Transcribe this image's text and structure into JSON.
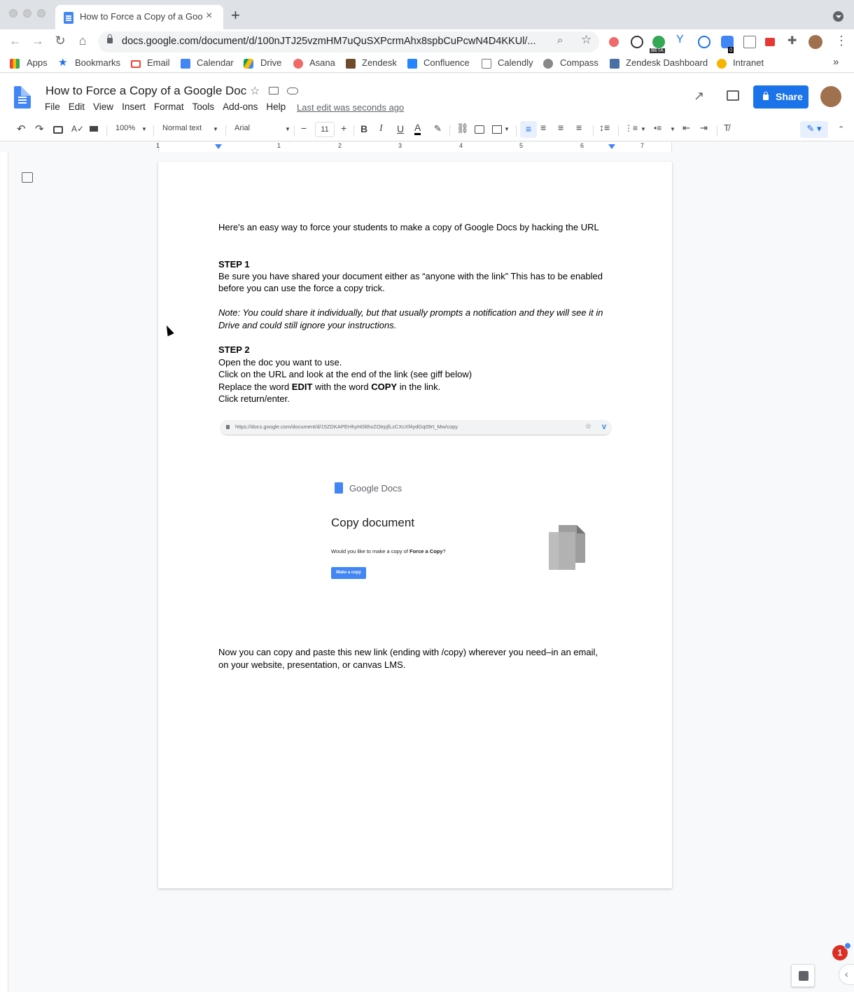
{
  "browser": {
    "tab_title": "How to Force a Copy of a Goog",
    "tab_close": "×",
    "new_tab": "+",
    "url": "docs.google.com/document/d/100nJTJ25vzmHM7uQuSXPcrmAhx8spbCuPcwN4D4KKUl/...",
    "extension_badges": {
      "beta": "BETA",
      "count": "0"
    }
  },
  "bookmarks": [
    {
      "label": "Apps",
      "icon": "apps-grid-icon"
    },
    {
      "label": "Bookmarks",
      "icon": "star-icon"
    },
    {
      "label": "Email",
      "icon": "gmail-icon"
    },
    {
      "label": "Calendar",
      "icon": "calendar-icon"
    },
    {
      "label": "Drive",
      "icon": "drive-icon"
    },
    {
      "label": "Asana",
      "icon": "asana-icon"
    },
    {
      "label": "Zendesk",
      "icon": "zendesk-icon"
    },
    {
      "label": "Confluence",
      "icon": "confluence-icon"
    },
    {
      "label": "Calendly",
      "icon": "calendly-icon"
    },
    {
      "label": "Compass",
      "icon": "compass-icon"
    },
    {
      "label": "Zendesk Dashboard",
      "icon": "zendesk-dashboard-icon"
    },
    {
      "label": "Intranet",
      "icon": "intranet-icon"
    }
  ],
  "bookmarks_more": "»",
  "doc": {
    "title": "How to Force a Copy of a Google Doc",
    "menu": [
      "File",
      "Edit",
      "View",
      "Insert",
      "Format",
      "Tools",
      "Add-ons",
      "Help"
    ],
    "last_edit": "Last edit was seconds ago",
    "share_label": "Share"
  },
  "toolbar": {
    "zoom": "100%",
    "style": "Normal text",
    "font": "Arial",
    "font_size": "11",
    "minus": "−",
    "plus": "+",
    "bold": "B",
    "italic": "I",
    "underline": "U",
    "text_color": "A"
  },
  "ruler_numbers": [
    "1",
    "1",
    "2",
    "3",
    "4",
    "5",
    "6",
    "7"
  ],
  "content": {
    "intro": "Here's an easy way to force your students to make a copy of Google Docs by hacking the URL",
    "step1_heading": "STEP 1",
    "step1_line1": "Be sure you have shared your document either as “anyone with the link” This has to be enabled",
    "step1_line2": "before you can use the force a copy trick.",
    "note_line1": "Note: You could share it individually, but that usually prompts a notification and they will see it in",
    "note_line2": "Drive and could still ignore your instructions.",
    "step2_heading": "STEP 2",
    "step2_line1": "Open the doc you want to use.",
    "step2_line2": "Click on the URL and look at the end of the link (see giff below)",
    "step2_line3_a": "Replace the word ",
    "step2_line3_edit": "EDIT",
    "step2_line3_b": " with the word ",
    "step2_line3_copy": "COPY",
    "step2_line3_c": " in the link.",
    "step2_line4": "Click return/enter.",
    "outro_line1": "Now you can copy and paste this new link (ending with /copy) wherever you need–in an email,",
    "outro_line2": "on your website, presentation, or canvas LMS."
  },
  "embedded_image": {
    "url": "https://docs.google.com/document/d/15ZDKAPEHhyHi5lthxZOtrpjfLzCXcXf4ydGq09rt_Mw/copy",
    "brand": "Google Docs",
    "heading": "Copy document",
    "question_prefix": "Would you like to make a copy of ",
    "question_doc": "Force a Copy",
    "question_suffix": "?",
    "button": "Make a copy"
  },
  "notification_count": "1",
  "colors": {
    "accent": "#1a73e8",
    "docs_blue": "#4285f4",
    "badge_red": "#d93025"
  }
}
